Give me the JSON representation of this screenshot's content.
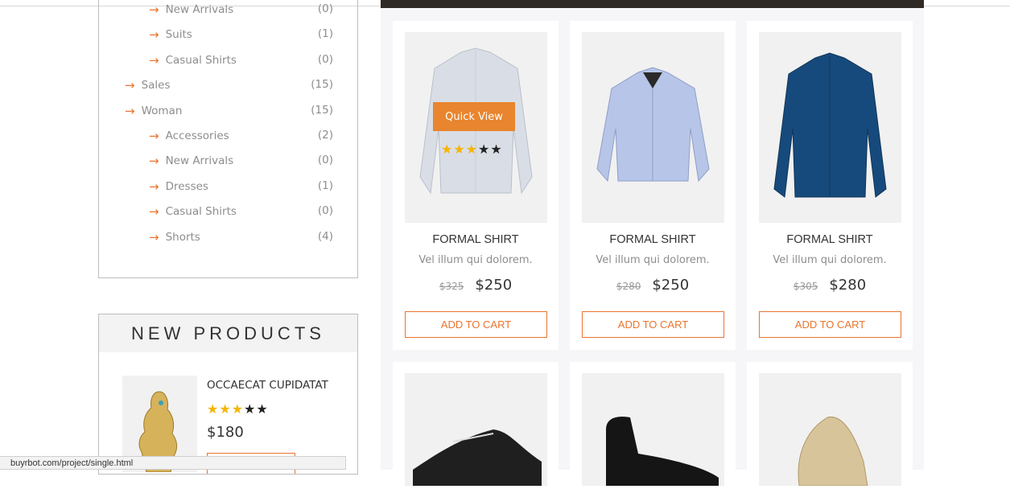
{
  "categories": [
    {
      "label": "New Arrivals",
      "count": "(0)",
      "level": 2
    },
    {
      "label": "Suits",
      "count": "(1)",
      "level": 2
    },
    {
      "label": "Casual Shirts",
      "count": "(0)",
      "level": 2
    },
    {
      "label": "Sales",
      "count": "(15)",
      "level": 1
    },
    {
      "label": "Woman",
      "count": "(15)",
      "level": 1
    },
    {
      "label": "Accessories",
      "count": "(2)",
      "level": 2
    },
    {
      "label": "New Arrivals",
      "count": "(0)",
      "level": 2
    },
    {
      "label": "Dresses",
      "count": "(1)",
      "level": 2
    },
    {
      "label": "Casual Shirts",
      "count": "(0)",
      "level": 2
    },
    {
      "label": "Shorts",
      "count": "(4)",
      "level": 2
    }
  ],
  "arrow_glyph": "→",
  "new_products": {
    "heading": "NEW PRODUCTS",
    "item": {
      "title": "OCCAECAT CUPIDATAT",
      "rating": 3,
      "price": "$180"
    }
  },
  "products": [
    {
      "name": "FORMAL SHIRT",
      "desc": "Vel illum qui dolorem.",
      "old_price": "$325",
      "price": "$250",
      "button": "ADD TO CART",
      "shirt_color": "#d9dee6"
    },
    {
      "name": "FORMAL SHIRT",
      "desc": "Vel illum qui dolorem.",
      "old_price": "$280",
      "price": "$250",
      "button": "ADD TO CART",
      "shirt_color": "#b7c5e8"
    },
    {
      "name": "FORMAL SHIRT",
      "desc": "Vel illum qui dolorem.",
      "old_price": "$305",
      "price": "$280",
      "button": "ADD TO CART",
      "shirt_color": "#174a7c"
    }
  ],
  "quick_view": {
    "label": "Quick View",
    "rating": 3
  },
  "status_url": "buyrbot.com/project/single.html",
  "colors": {
    "accent": "#e8752e",
    "star": "#f6b400"
  }
}
